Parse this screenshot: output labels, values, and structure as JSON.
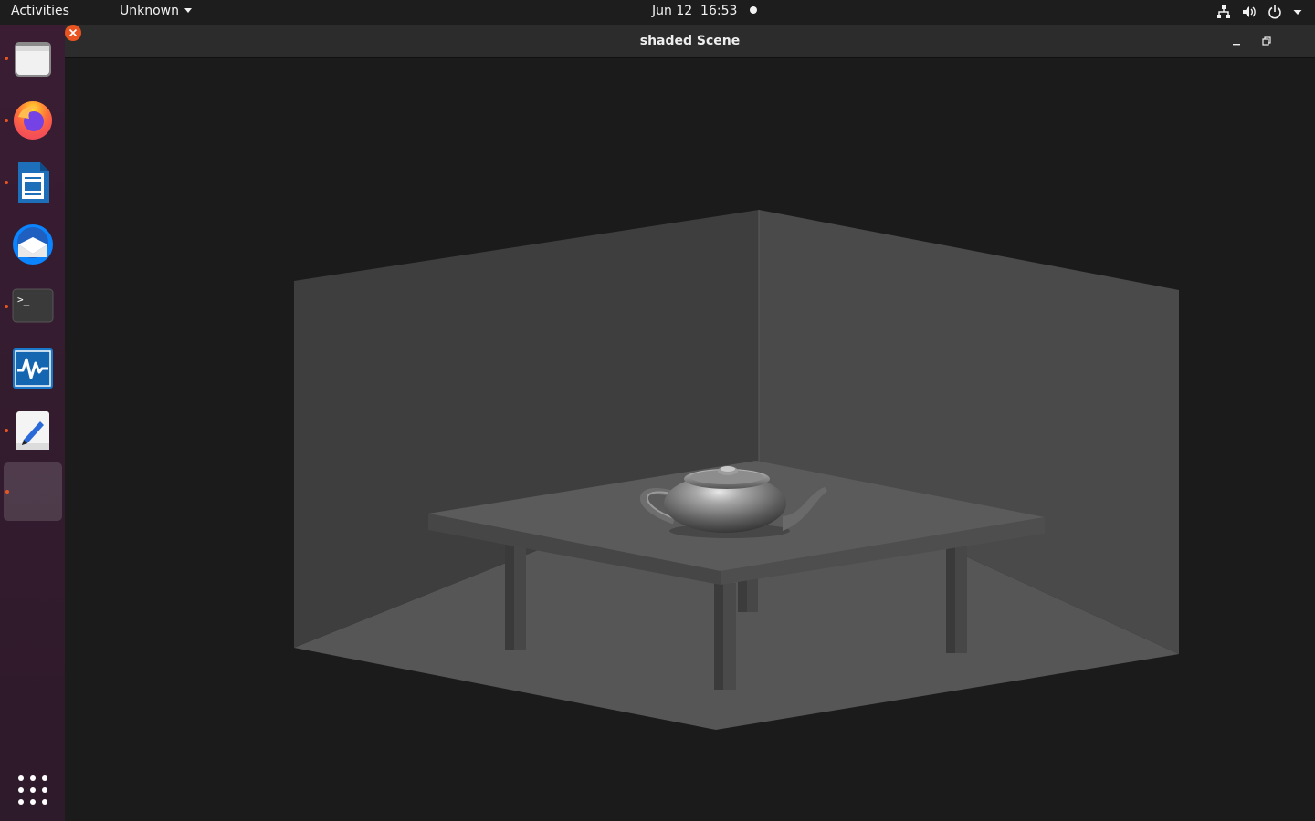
{
  "topbar": {
    "activities": "Activities",
    "app_menu": "Unknown",
    "date": "Jun 12",
    "time": "16:53",
    "tray_icons": [
      "network-icon",
      "volume-icon",
      "power-icon",
      "chevron-down-icon"
    ]
  },
  "dock": {
    "items": [
      {
        "name": "files",
        "icon": "files-icon",
        "running": true
      },
      {
        "name": "firefox",
        "icon": "firefox-icon",
        "running": true
      },
      {
        "name": "libreoffice-writer",
        "icon": "writer-icon",
        "running": true
      },
      {
        "name": "thunderbird",
        "icon": "thunderbird-icon",
        "running": false
      },
      {
        "name": "terminal",
        "icon": "terminal-icon",
        "running": true
      },
      {
        "name": "system-monitor",
        "icon": "monitor-icon",
        "running": false
      },
      {
        "name": "text-editor",
        "icon": "text-editor-icon",
        "running": true
      },
      {
        "name": "shaded-scene-app",
        "icon": "app-icon",
        "running": true,
        "active": true
      }
    ],
    "show_apps_icon": "grid-icon",
    "accent_color": "#e95420"
  },
  "window": {
    "title": "shaded Scene",
    "close_color": "#e95420"
  },
  "scene": {
    "objects": [
      "left-wall",
      "back-wall",
      "floor",
      "table",
      "teapot"
    ],
    "colors": {
      "background": "#1b1b1b",
      "left_wall": "#3e3e3e",
      "back_wall": "#4a4a4a",
      "floor": "#555555",
      "table_top": "#5a5a5a",
      "table_edge": "#404040",
      "teapot": "#7a7a7a"
    }
  }
}
